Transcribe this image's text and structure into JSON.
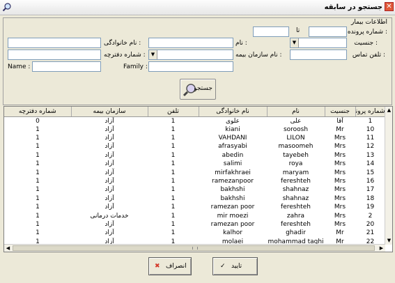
{
  "window": {
    "title": "جستجو در سابقه",
    "close_glyph": "✕"
  },
  "patient_info": {
    "group_label": "اطلاعات بیمار",
    "record_no_label": "شماره پرونده :",
    "to_label": "تا",
    "gender_label": "جنسیت :",
    "first_name_label": "نام :",
    "last_name_label": "نام خانوادگی :",
    "insurance_label": "نام سازمان بیمه :",
    "booklet_no_label": "شماره دفترچه :",
    "phone_label": "تلفن تماس :",
    "family_label": "Family :",
    "name_label": "Name :",
    "record_from_value": "",
    "record_to_value": "",
    "gender_value": "",
    "first_name_value": "",
    "last_name_value": "",
    "insurance_value": "",
    "booklet_value": "",
    "phone_value": "",
    "family_value": "",
    "name_value": ""
  },
  "search_button": {
    "label": "جستجو",
    "icon": "magnifier-icon"
  },
  "table": {
    "columns": [
      "شماره پرونده",
      "جنسیت",
      "نام",
      "نام خانوادگی",
      "تلفن",
      "سازمان بیمه",
      "شماره دفترچه"
    ],
    "rows": [
      [
        "1",
        "آقا",
        "علی",
        "علوی",
        "1",
        "آزاد",
        "0"
      ],
      [
        "10",
        "Mr",
        "soroosh",
        "kiani",
        "1",
        "آزاد",
        "1"
      ],
      [
        "11",
        "Mrs",
        "LILON",
        "VAHDANI",
        "1",
        "آزاد",
        "1"
      ],
      [
        "12",
        "Mrs",
        "masoomeh",
        "afrasyabi",
        "1",
        "آزاد",
        "1"
      ],
      [
        "13",
        "Mrs",
        "tayebeh",
        "abedin",
        "1",
        "آزاد",
        "1"
      ],
      [
        "14",
        "Mrs",
        "roya",
        "salimi",
        "1",
        "آزاد",
        "1"
      ],
      [
        "15",
        "Mrs",
        "maryam",
        "mirfakhraei",
        "1",
        "آزاد",
        "1"
      ],
      [
        "16",
        "Mrs",
        "fereshteh",
        "ramezanpoor",
        "1",
        "آزاد",
        "1"
      ],
      [
        "17",
        "Mrs",
        "shahnaz",
        "bakhshi",
        "1",
        "آزاد",
        "1"
      ],
      [
        "18",
        "Mrs",
        "shahnaz",
        "bakhshi",
        "1",
        "آزاد",
        "1"
      ],
      [
        "19",
        "Mrs",
        "fereshteh",
        "ramezan poor",
        "1",
        "آزاد",
        "1"
      ],
      [
        "2",
        "Mrs",
        "zahra",
        "mir moezi",
        "1",
        "خدمات درمانی",
        "1"
      ],
      [
        "20",
        "Mrs",
        "fereshteh",
        "ramezan poor",
        "1",
        "آزاد",
        "1"
      ],
      [
        "21",
        "Mr",
        "ghadir",
        "kalhor",
        "1",
        "آزاد",
        "1"
      ],
      [
        "22",
        "Mr",
        "mohammad taghi",
        "molaei",
        "1",
        "آزاد",
        "1"
      ]
    ]
  },
  "footer": {
    "confirm_label": "تایید",
    "cancel_label": "انصراف",
    "confirm_icon": "check-icon",
    "cancel_icon": "cross-icon"
  },
  "colors": {
    "accent_red": "#d43a2a",
    "window_bg": "#ece9d8"
  }
}
